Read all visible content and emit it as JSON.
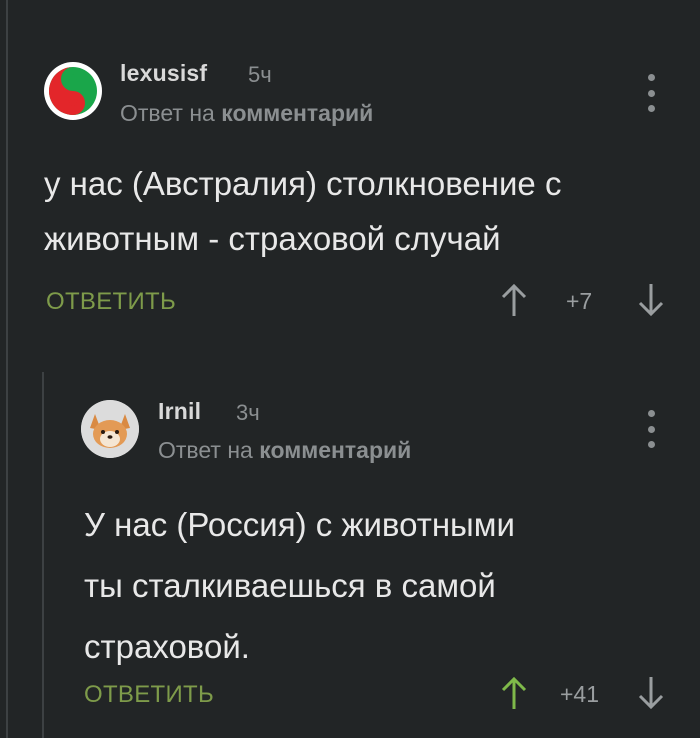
{
  "comments": [
    {
      "username": "lexusisf",
      "time": "5ч",
      "reply_prefix": "Ответ на",
      "reply_target": "комментарий",
      "text_lines": [
        "у нас (Австралия) столкновение с",
        "животным - страховой случай"
      ],
      "reply_label": "ОТВЕТИТЬ",
      "rating": "+7",
      "upvoted": false
    },
    {
      "username": "Irnil",
      "time": "3ч",
      "reply_prefix": "Ответ на",
      "reply_target": "комментарий",
      "text_lines": [
        "У нас (Россия) с животными",
        "ты сталкиваешься в самой",
        "страховой."
      ],
      "reply_label": "ОТВЕТИТЬ",
      "rating": "+41",
      "upvoted": true
    }
  ],
  "icons": {
    "menu": "more-vertical-icon",
    "up": "arrow-up-icon",
    "down": "arrow-down-icon"
  },
  "colors": {
    "background": "#222526",
    "accent_green": "#7e9b4a",
    "upvote_active": "#7fb94a",
    "muted": "#8b8f91"
  }
}
